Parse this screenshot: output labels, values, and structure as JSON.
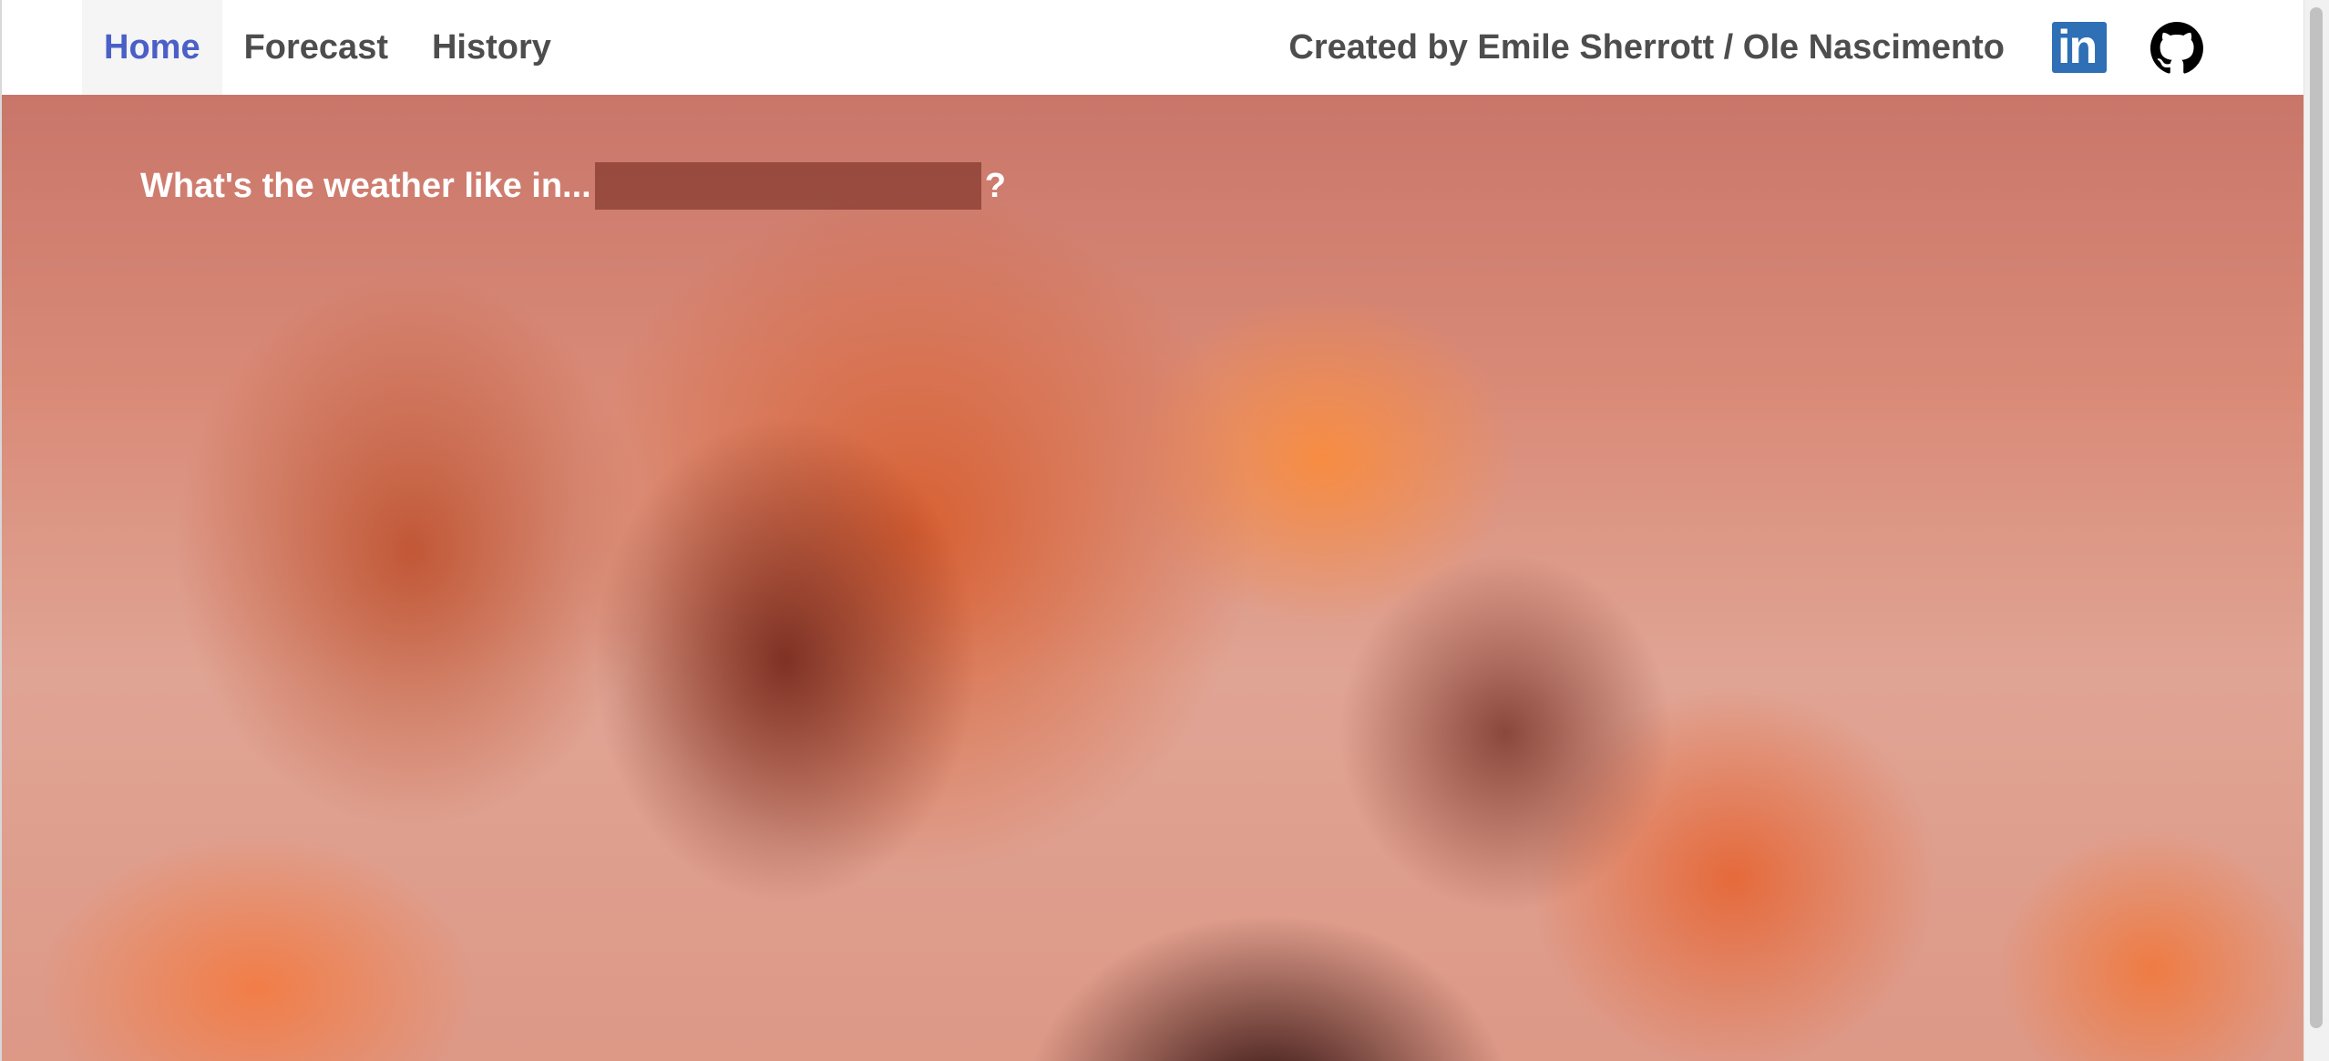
{
  "nav": {
    "links": [
      {
        "label": "Home",
        "active": true
      },
      {
        "label": "Forecast",
        "active": false
      },
      {
        "label": "History",
        "active": false
      }
    ],
    "credit": "Created by Emile Sherrott / Ole Nascimento",
    "icons": {
      "linkedin": {
        "name": "linkedin-icon",
        "glyph": "in",
        "color": "#2e6fb5"
      },
      "github": {
        "name": "github-icon",
        "color": "#000000"
      }
    },
    "active_color": "#4a5fc7"
  },
  "hero": {
    "question": "What's the weather like in...",
    "input_value": "",
    "input_placeholder": "",
    "question_mark": "?"
  }
}
